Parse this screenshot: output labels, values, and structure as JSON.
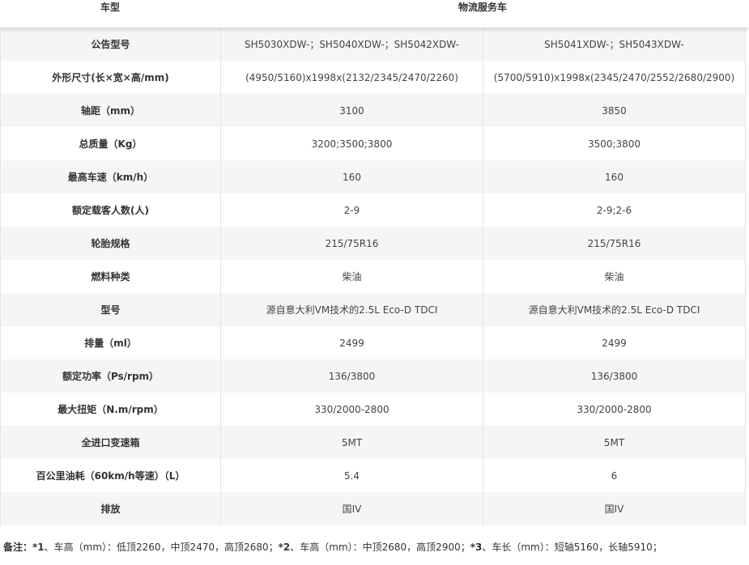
{
  "header": {
    "label": "车型",
    "value": "物流服务车"
  },
  "rows": [
    {
      "label": "公告型号",
      "a": "SH5030XDW-；SH5040XDW-；SH5042XDW-",
      "b": "SH5041XDW-；SH5043XDW-"
    },
    {
      "label": "外形尺寸(长×宽×高/mm)",
      "a": "(4950/5160)x1998x(2132/2345/2470/2260)",
      "b": "(5700/5910)x1998x(2345/2470/2552/2680/2900)"
    },
    {
      "label": "轴距（mm）",
      "a": "3100",
      "b": "3850"
    },
    {
      "label": "总质量（Kg）",
      "a": "3200;3500;3800",
      "b": "3500;3800"
    },
    {
      "label": "最高车速（km/h）",
      "a": "160",
      "b": "160"
    },
    {
      "label": "额定载客人数(人)",
      "a": "2-9",
      "b": "2-9;2-6"
    },
    {
      "label": "轮胎规格",
      "a": "215/75R16",
      "b": "215/75R16"
    },
    {
      "label": "燃料种类",
      "a": "柴油",
      "b": "柴油"
    },
    {
      "label": "型号",
      "a": "源自意大利VM技术的2.5L Eco-D TDCI",
      "b": "源自意大利VM技术的2.5L Eco-D TDCI"
    },
    {
      "label": "排量（ml）",
      "a": "2499",
      "b": "2499"
    },
    {
      "label": "额定功率（Ps/rpm）",
      "a": "136/3800",
      "b": "136/3800"
    },
    {
      "label": "最大扭矩（N.m/rpm）",
      "a": "330/2000-2800",
      "b": "330/2000-2800"
    },
    {
      "label": "全进口变速箱",
      "a": "5MT",
      "b": "5MT"
    },
    {
      "label": "百公里油耗（60km/h等速）（L）",
      "a": "5.4",
      "b": "6"
    },
    {
      "label": "排放",
      "a": "国IV",
      "b": "国IV"
    }
  ],
  "note": {
    "prefix": "备注：",
    "p1_mark": "*1",
    "p1_text": "、车高（mm）：低顶2260，中顶2470，高顶2680；",
    "p2_mark": "*2",
    "p2_text": "、车高（mm）：中顶2680，高顶2900；",
    "p3_mark": "*3",
    "p3_text": "、车长（mm）：短轴5160，长轴5910；"
  }
}
